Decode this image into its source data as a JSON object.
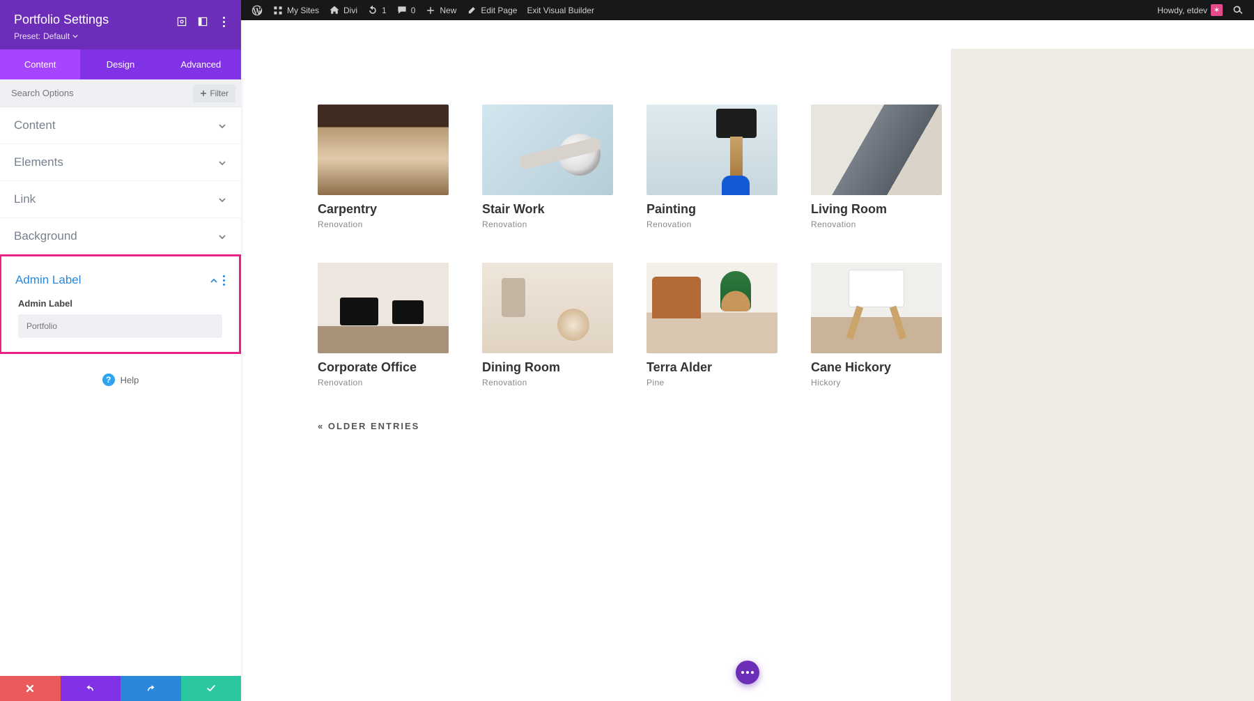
{
  "adminbar": {
    "mysites": "My Sites",
    "divi": "Divi",
    "updates": "1",
    "comments": "0",
    "new": "New",
    "edit": "Edit Page",
    "exit": "Exit Visual Builder",
    "howdy": "Howdy, etdev"
  },
  "panel": {
    "title": "Portfolio Settings",
    "preset_label": "Preset:",
    "preset_value": "Default",
    "tabs": {
      "content": "Content",
      "design": "Design",
      "advanced": "Advanced"
    },
    "search_placeholder": "Search Options",
    "filter": "Filter",
    "toggles": {
      "content": "Content",
      "elements": "Elements",
      "link": "Link",
      "background": "Background",
      "admin_label": "Admin Label"
    },
    "admin_label_field": "Admin Label",
    "admin_label_placeholder": "Portfolio",
    "help": "Help"
  },
  "portfolio": {
    "row1": [
      {
        "title": "Carpentry",
        "cat": "Renovation"
      },
      {
        "title": "Stair Work",
        "cat": "Renovation"
      },
      {
        "title": "Painting",
        "cat": "Renovation"
      },
      {
        "title": "Living Room",
        "cat": "Renovation"
      }
    ],
    "row2": [
      {
        "title": "Corporate Office",
        "cat": "Renovation"
      },
      {
        "title": "Dining Room",
        "cat": "Renovation"
      },
      {
        "title": "Terra Alder",
        "cat": "Pine"
      },
      {
        "title": "Cane Hickory",
        "cat": "Hickory"
      }
    ],
    "older": "« OLDER ENTRIES"
  }
}
